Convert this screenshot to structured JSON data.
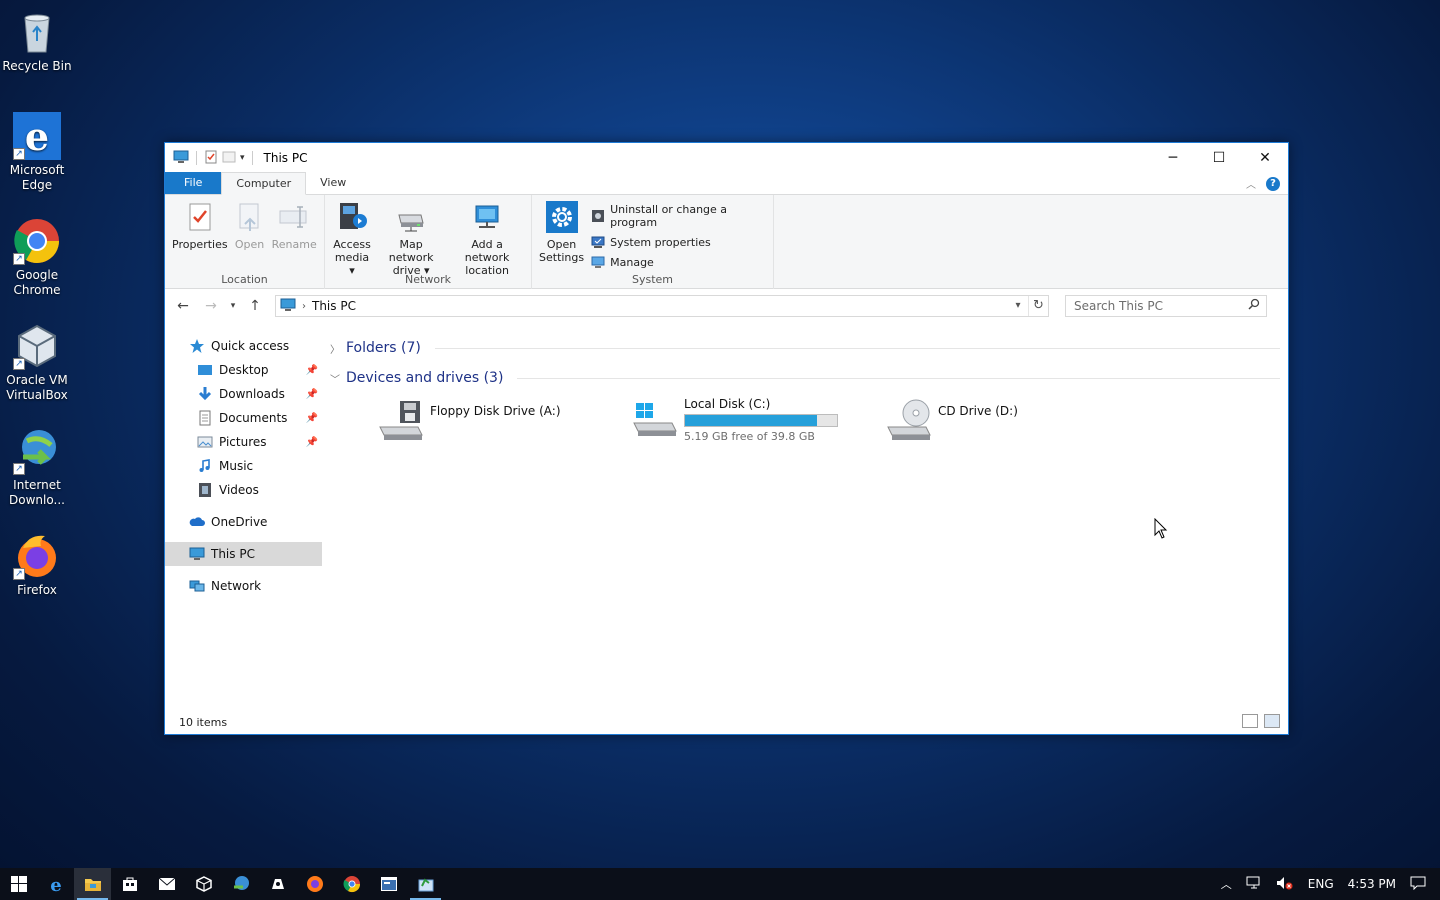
{
  "desktop": {
    "icons": [
      {
        "label": "Recycle Bin",
        "icon": "recycle-bin-icon"
      },
      {
        "label": "Microsoft Edge",
        "icon": "edge-icon"
      },
      {
        "label": "Google Chrome",
        "icon": "chrome-icon"
      },
      {
        "label": "Oracle VM VirtualBox",
        "icon": "virtualbox-icon"
      },
      {
        "label": "Internet Downlo...",
        "icon": "internet-download-manager-icon"
      },
      {
        "label": "Firefox",
        "icon": "firefox-icon"
      }
    ]
  },
  "window": {
    "title": "This PC",
    "controls": {
      "minimize": "─",
      "maximize": "☐",
      "close": "✕"
    }
  },
  "tabs": {
    "file": "File",
    "computer": "Computer",
    "view": "View"
  },
  "ribbon": {
    "location": {
      "label": "Location",
      "properties": "Properties",
      "open": "Open",
      "rename": "Rename"
    },
    "network": {
      "label": "Network",
      "access_media_1": "Access",
      "access_media_2": "media ▾",
      "map_drive_1": "Map network",
      "map_drive_2": "drive ▾",
      "add_location_1": "Add a network",
      "add_location_2": "location"
    },
    "system": {
      "label": "System",
      "open_settings_1": "Open",
      "open_settings_2": "Settings",
      "uninstall": "Uninstall or change a program",
      "system_properties": "System properties",
      "manage": "Manage"
    }
  },
  "address": {
    "crumb": "This PC",
    "search_placeholder": "Search This PC"
  },
  "navpane": {
    "quick_access": "Quick access",
    "items": [
      "Desktop",
      "Downloads",
      "Documents",
      "Pictures",
      "Music",
      "Videos"
    ],
    "onedrive": "OneDrive",
    "this_pc": "This PC",
    "network": "Network"
  },
  "content": {
    "folders_header": "Folders (7)",
    "devices_header": "Devices and drives (3)",
    "drives": [
      {
        "name": "Floppy Disk Drive (A:)"
      },
      {
        "name": "Local Disk (C:)",
        "free": "5.19 GB free of 39.8 GB",
        "used_fraction": 0.87
      },
      {
        "name": "CD Drive (D:)"
      }
    ]
  },
  "status": {
    "items": "10 items"
  },
  "taskbar": {
    "apps": [
      "start-icon",
      "edge-icon",
      "file-explorer-icon",
      "store-icon",
      "mail-icon",
      "virtualbox-icon",
      "internet-download-manager-icon",
      "photos-icon",
      "firefox-icon",
      "chrome-icon",
      "window-icon",
      "notepad-icon"
    ],
    "language": "ENG",
    "time": "4:53 PM"
  },
  "colors": {
    "accent": "#1979ca",
    "selection": "#d9d9d9",
    "progress": "#26a0da"
  }
}
